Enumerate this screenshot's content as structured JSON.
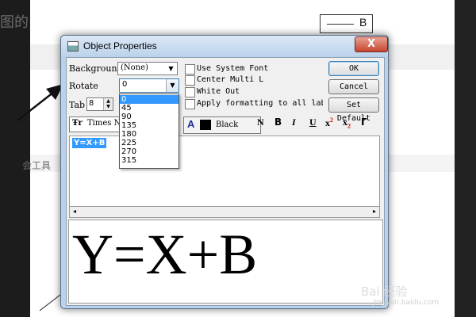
{
  "background_doc": {
    "fragment_top": "图的",
    "fragment_mid": "会工具",
    "legend_label": "B"
  },
  "dialog": {
    "title": "Object Properties",
    "close_label": "X",
    "background_label": "Background",
    "background_value": "(None)",
    "rotate_label": "Rotate",
    "rotate_value": "0",
    "rotate_options": [
      "0",
      "45",
      "90",
      "135",
      "180",
      "225",
      "270",
      "315"
    ],
    "tab_label": "Tab",
    "tab_value": "8",
    "font_value": "Times N",
    "color_value": "Black",
    "checkboxes": [
      "Use System Font",
      "Center Multi L",
      "White Out",
      "Apply formatting to all label"
    ],
    "buttons": {
      "ok": "OK",
      "cancel": "Cancel",
      "set_default": "Set Default"
    },
    "toolbar": {
      "a_glyph": "A",
      "normal": "N",
      "bold": "B",
      "italic": "I",
      "underline": "U",
      "superscript": "x",
      "sup_mark": "2",
      "subscript": "x",
      "sub_mark": "2",
      "gamma": "Γ"
    },
    "edit_text": "Y=X+B",
    "preview_text": "Y=X+B"
  },
  "watermark": {
    "text": "Bai 经验",
    "sub": "jingyan.baidu.com"
  },
  "colors": {
    "selection": "#3399ff",
    "title_grad_top": "#dbe8f6",
    "close_button": "#c7442f"
  }
}
